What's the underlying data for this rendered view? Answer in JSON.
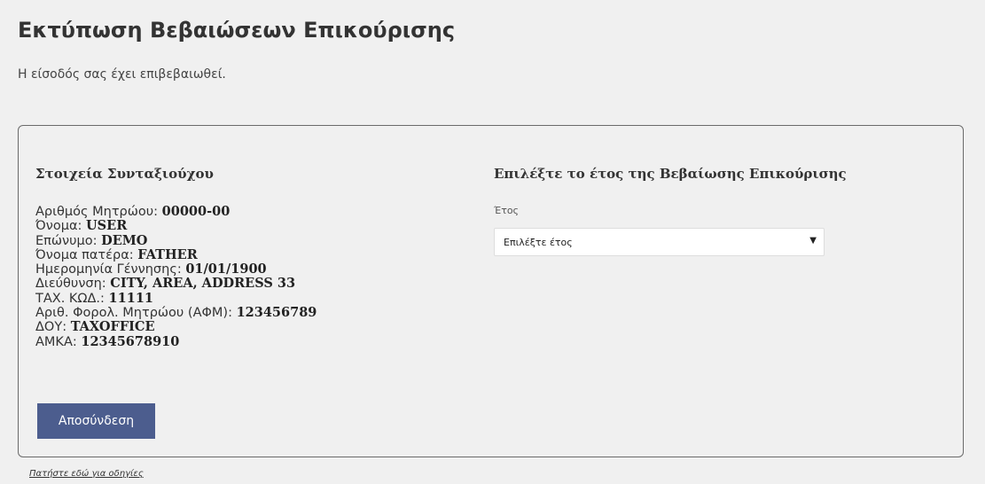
{
  "page": {
    "title": "Εκτύπωση Βεβαιώσεων Επικούρισης",
    "login_message": "Η είσοδός σας έχει επιβεβαιωθεί."
  },
  "pensioner": {
    "heading": "Στοιχεία Συνταξιούχου",
    "fields": [
      {
        "label": "Αριθμός Μητρώου: ",
        "value": "00000-00"
      },
      {
        "label": "Όνομα: ",
        "value": "USER"
      },
      {
        "label": "Επώνυμο: ",
        "value": "DEMO"
      },
      {
        "label": "Όνομα πατέρα: ",
        "value": "FATHER"
      },
      {
        "label": "Ημερομηνία Γέννησης: ",
        "value": "01/01/1900"
      },
      {
        "label": "Διεύθυνση: ",
        "value": "CITY, AREA, ADDRESS 33"
      },
      {
        "label": "ΤΑΧ. ΚΩΔ.: ",
        "value": "11111"
      },
      {
        "label": "Αριθ. Φορολ. Μητρώου (ΑΦΜ): ",
        "value": "123456789"
      },
      {
        "label": "ΔΟΥ: ",
        "value": "TAXOFFICE"
      },
      {
        "label": "ΑΜΚΑ: ",
        "value": "12345678910"
      }
    ],
    "logout_label": "Αποσύνδεση"
  },
  "year_selection": {
    "heading": "Επιλέξτε το έτος της Βεβαίωσης Επικούρισης",
    "field_label": "Έτος",
    "selected_value": "Επιλέξτε έτος",
    "caret_icon": "caret-down-icon"
  },
  "footer": {
    "help_link": "Πατήστε εδώ για οδηγίες"
  }
}
